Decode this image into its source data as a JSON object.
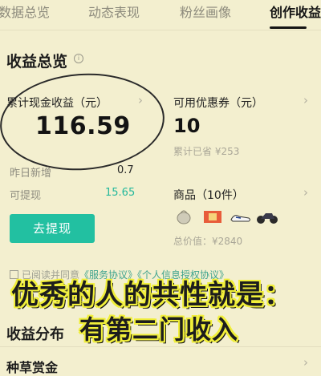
{
  "tabs": [
    {
      "label": "数据总览"
    },
    {
      "label": "动态表现"
    },
    {
      "label": "粉丝画像"
    },
    {
      "label": "创作收益"
    }
  ],
  "overview": {
    "title": "收益总览",
    "info_icon": "info-icon"
  },
  "cash_card": {
    "label": "累计现金收益（元）",
    "value": "116.59",
    "yesterday_label": "昨日新增",
    "yesterday_value": "0.7",
    "withdrawable_label": "可提现",
    "withdrawable_value": "15.65",
    "withdraw_button": "去提现"
  },
  "coupon_card": {
    "label": "可用优惠券（元）",
    "value": "10",
    "saved_text": "累计已省 ¥253"
  },
  "goods_card": {
    "label": "商品（10件）",
    "total_text": "总价值：¥2840",
    "thumbnails": [
      "bag-thumbnail",
      "gift-box-thumbnail",
      "sneaker-thumbnail",
      "motorcycle-thumbnail"
    ]
  },
  "agreement": {
    "prefix": "已阅读并同意",
    "link": "《服务协议》《个人信息授权协议》"
  },
  "overlay": {
    "line1": "优秀的人的共性就是：",
    "line2": "有第二门收入"
  },
  "distribution": {
    "title": "收益分布"
  },
  "reward": {
    "title": "种草赏金"
  },
  "colors": {
    "background": "#f3efcf",
    "accent": "#22c0a1",
    "overlay_fill": "#f1ef3a"
  }
}
